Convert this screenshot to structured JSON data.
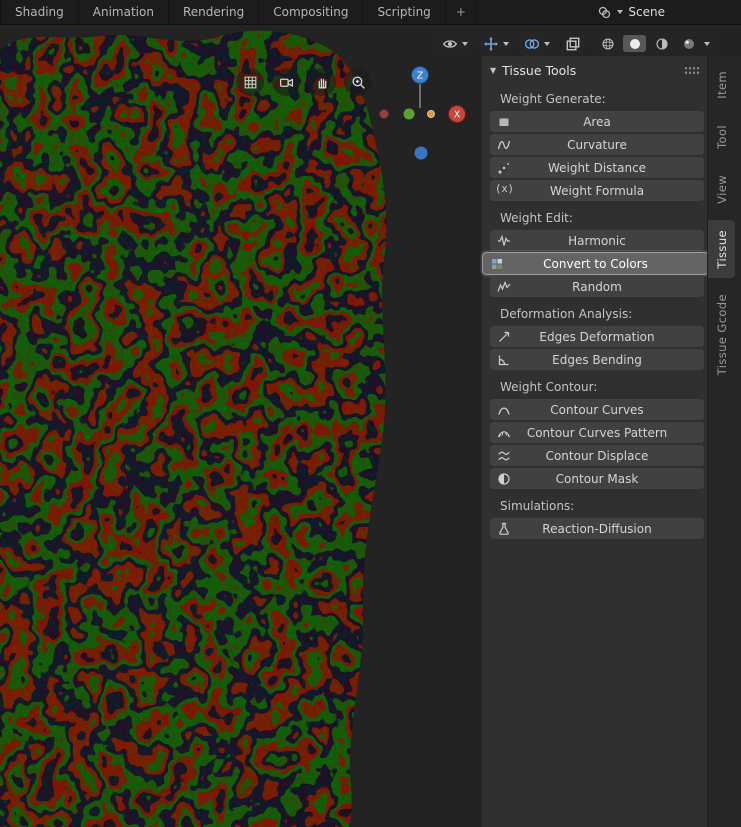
{
  "topbar": {
    "workspace_tabs": [
      "Shading",
      "Animation",
      "Rendering",
      "Compositing",
      "Scripting"
    ],
    "add_workspace_label": "+",
    "scene_selector": {
      "label": "Scene"
    }
  },
  "viewport": {
    "header_icons": [
      "visibility-icon",
      "gizmos-icon",
      "overlays-icon",
      "xray-icon",
      "shading-wireframe-icon",
      "shading-solid-icon",
      "shading-material-icon",
      "shading-rendered-icon"
    ],
    "corner_buttons": [
      "grid-icon",
      "camera-icon",
      "pan-hand-icon",
      "zoom-icon"
    ],
    "nav_gizmo": {
      "z_label": "Z",
      "x_label": "X"
    }
  },
  "glyphs": {
    "collapse_arrow": "▼",
    "weight_formula": "(x)"
  },
  "sidebar": {
    "panel": {
      "title": "Tissue Tools",
      "sections": [
        {
          "label": "Weight Generate:",
          "buttons": [
            {
              "label": "Area",
              "icon": "area-icon"
            },
            {
              "label": "Curvature",
              "icon": "curvature-icon"
            },
            {
              "label": "Weight Distance",
              "icon": "weight-distance-icon"
            },
            {
              "label": "Weight Formula",
              "icon": "weight-formula-icon"
            }
          ]
        },
        {
          "label": "Weight Edit:",
          "buttons": [
            {
              "label": "Harmonic",
              "icon": "harmonic-icon"
            },
            {
              "label": "Convert to Colors",
              "icon": "convert-to-colors-icon",
              "highlighted": true
            },
            {
              "label": "Random",
              "icon": "random-icon"
            }
          ]
        },
        {
          "label": "Deformation Analysis:",
          "buttons": [
            {
              "label": "Edges Deformation",
              "icon": "edges-deformation-icon"
            },
            {
              "label": "Edges Bending",
              "icon": "edges-bending-icon"
            }
          ]
        },
        {
          "label": "Weight Contour:",
          "buttons": [
            {
              "label": "Contour Curves",
              "icon": "contour-curves-icon"
            },
            {
              "label": "Contour Curves Pattern",
              "icon": "contour-curves-pattern-icon"
            },
            {
              "label": "Contour Displace",
              "icon": "contour-displace-icon"
            },
            {
              "label": "Contour Mask",
              "icon": "contour-mask-icon"
            }
          ]
        },
        {
          "label": "Simulations:",
          "buttons": [
            {
              "label": "Reaction-Diffusion",
              "icon": "reaction-diffusion-icon"
            }
          ]
        }
      ]
    },
    "tabs": [
      {
        "label": "Item",
        "active": false
      },
      {
        "label": "Tool",
        "active": false
      },
      {
        "label": "View",
        "active": false
      },
      {
        "label": "Tissue",
        "active": true
      },
      {
        "label": "Tissue Gcode",
        "active": false
      }
    ]
  },
  "colors": {
    "accent_blue": "#71a7e3",
    "axis_z_blue": "#3e7fce",
    "axis_x_red": "#c9463e",
    "pattern_red": "#941400",
    "pattern_green": "#3f7000",
    "pattern_dark_blue": "#101433",
    "panel_bg": "#303030",
    "button_bg": "#414141"
  }
}
